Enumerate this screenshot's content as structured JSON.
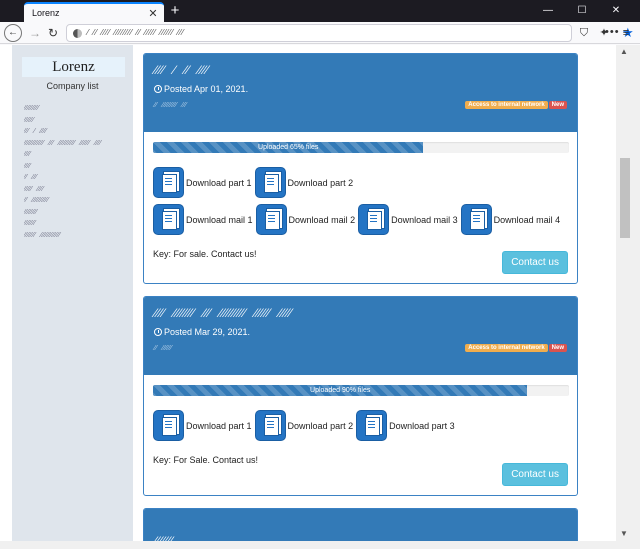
{
  "browser": {
    "tab_title": "Lorenz",
    "tab_close": "✕",
    "new_tab": "+",
    "url_obscured": "⁄  ⁄⁄ ⁄⁄⁄⁄  ⁄⁄⁄⁄⁄⁄⁄⁄ ⁄⁄ ⁄⁄⁄⁄⁄  ⁄⁄⁄⁄⁄⁄ ⁄⁄⁄",
    "win_min": "—",
    "win_max": "☐",
    "win_close": "✕",
    "back": "←",
    "forward": "→",
    "reload": "↻",
    "more": "•••",
    "star": "★",
    "shield": "⛉",
    "ext": "✦",
    "menu": "≡"
  },
  "sidebar": {
    "brand": "Lorenz",
    "company_list_label": "Company list",
    "companies": [
      "⁄⁄⁄⁄⁄⁄⁄⁄⁄",
      " ⁄⁄⁄⁄⁄⁄",
      "⁄⁄⁄ ⁄ ⁄⁄⁄⁄",
      "⁄⁄⁄⁄⁄⁄⁄⁄⁄⁄⁄⁄ ⁄⁄⁄ ⁄⁄⁄⁄⁄⁄⁄⁄⁄⁄ ⁄⁄⁄⁄⁄⁄ ⁄⁄⁄⁄",
      " ⁄⁄⁄⁄",
      "⁄⁄⁄⁄",
      " ⁄⁄ ⁄⁄⁄",
      " ⁄⁄⁄⁄⁄ ⁄⁄⁄⁄",
      " ⁄⁄ ⁄⁄⁄⁄⁄⁄⁄⁄⁄⁄",
      "⁄⁄⁄⁄⁄⁄⁄⁄",
      "⁄⁄⁄⁄⁄⁄⁄",
      "⁄⁄⁄⁄⁄⁄⁄ ⁄⁄⁄⁄⁄⁄⁄⁄⁄⁄⁄⁄"
    ]
  },
  "cards": [
    {
      "title": "⁄⁄⁄⁄ ⁄ ⁄⁄ ⁄⁄⁄⁄",
      "date": "Posted Apr 01, 2021.",
      "sub": "⁄⁄ ⁄⁄⁄⁄⁄⁄⁄⁄⁄ ⁄⁄⁄",
      "badge_access": "Access to internal network",
      "badge_new": "New",
      "progress_label": "Uploaded 65% files",
      "progress": 65,
      "row1": [
        "Download part 1",
        "Download part 2"
      ],
      "row2": [
        "Download mail 1",
        "Download mail 2",
        "Download mail 3",
        "Download mail 4"
      ],
      "key": "Key: For sale. Contact us!",
      "contact": "Contact us"
    },
    {
      "title": "⁄⁄⁄⁄ ⁄⁄⁄⁄⁄⁄⁄⁄ ⁄⁄⁄ ⁄⁄⁄⁄⁄⁄⁄⁄⁄⁄ ⁄⁄⁄⁄⁄⁄ ⁄⁄⁄⁄⁄",
      "date": "Posted Mar 29, 2021.",
      "sub": "⁄⁄ ⁄⁄⁄⁄⁄⁄",
      "badge_access": "Access to internal network",
      "badge_new": "New",
      "progress_label": "Uploaded 90% files",
      "progress": 90,
      "row1": [
        "Download part 1",
        "Download part 2",
        "Download part 3"
      ],
      "key": "Key: For Sale. Contact us!",
      "contact": "Contact us"
    },
    {
      "title": "⁄⁄⁄⁄⁄⁄⁄"
    }
  ]
}
